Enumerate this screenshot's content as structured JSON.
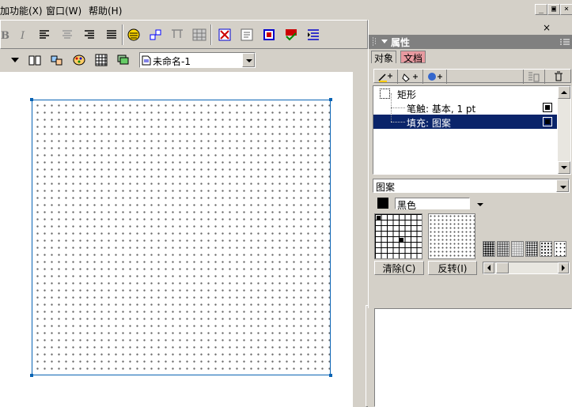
{
  "menubar": {
    "items": [
      "加功能(X)",
      "窗口(W)",
      "帮助(H)"
    ],
    "window_buttons": [
      "_",
      "▣",
      "×"
    ]
  },
  "document": {
    "name": "未命名-1"
  },
  "properties_panel": {
    "title": "属性",
    "tabs": [
      "对象",
      "文档"
    ],
    "object_tree": {
      "root": "矩形",
      "children": [
        {
          "label": "笔触: 基本, 1 pt",
          "selected": false
        },
        {
          "label": "填充: 图案",
          "selected": true
        }
      ]
    },
    "fill_type": "图案",
    "color": {
      "name": "黑色",
      "value": "#000000"
    },
    "buttons": {
      "clear": "清除(C)",
      "invert": "反转(I)"
    }
  },
  "colors": {
    "selection": "#0a246a",
    "object_outline": "#0a64b4",
    "doc_tab": "#e79aa0"
  }
}
